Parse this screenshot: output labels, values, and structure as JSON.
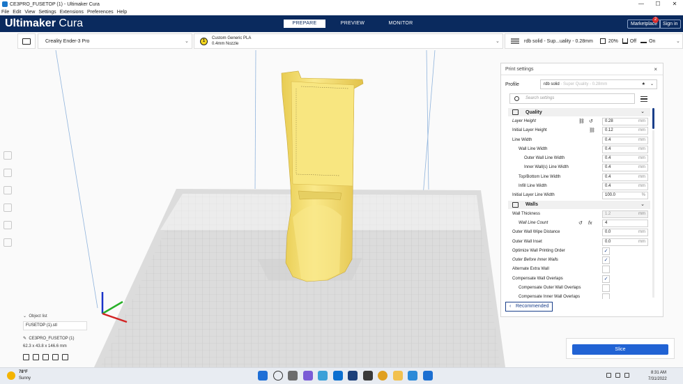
{
  "window": {
    "title": "CE3PRO_FUSETOP (1) - Ultimaker Cura",
    "minimize": "—",
    "maximize": "☐",
    "close": "✕"
  },
  "menu": [
    "File",
    "Edit",
    "View",
    "Settings",
    "Extensions",
    "Preferences",
    "Help"
  ],
  "header": {
    "logo_bold": "Ultimaker",
    "logo_light": " Cura",
    "stages": [
      "PREPARE",
      "PREVIEW",
      "MONITOR"
    ],
    "active_stage": 0,
    "marketplace": "Marketplace",
    "marketplace_badge": "2",
    "signin": "Sign in"
  },
  "toolbar": {
    "printer": "Creality Ender-3 Pro",
    "extruder_number": "1",
    "material": "Custom Generic PLA",
    "nozzle": "0.4mm Nozzle",
    "profile_summary": "rdb solid - Sup...uality - 0.28mm",
    "infill": "20%",
    "support": "Off",
    "adhesion": "On"
  },
  "object_list": {
    "label": "Object list",
    "file": "FUSETOP (1).stl",
    "object_name": "CE3PRO_FUSETOP (1)",
    "dimensions": "62.3 x 43.8 x 146.6 mm"
  },
  "print_settings": {
    "title": "Print settings",
    "close": "×",
    "profile_label": "Profile",
    "profile_name": "rdb solid",
    "profile_sub": " - Super Quality - 0.28mm",
    "search_placeholder": "Search settings",
    "categories": {
      "quality": "Quality",
      "walls": "Walls"
    },
    "quality_rows": [
      {
        "label": "Layer Height",
        "value": "0.28",
        "unit": "mm"
      },
      {
        "label": "Initial Layer Height",
        "value": "0.12",
        "unit": "mm"
      },
      {
        "label": "Line Width",
        "value": "0.4",
        "unit": "mm"
      },
      {
        "label": "Wall Line Width",
        "value": "0.4",
        "unit": "mm"
      },
      {
        "label": "Outer Wall Line Width",
        "value": "0.4",
        "unit": "mm"
      },
      {
        "label": "Inner Wall(s) Line Width",
        "value": "0.4",
        "unit": "mm"
      },
      {
        "label": "Top/Bottom Line Width",
        "value": "0.4",
        "unit": "mm"
      },
      {
        "label": "Infill Line Width",
        "value": "0.4",
        "unit": "mm"
      },
      {
        "label": "Initial Layer Line Width",
        "value": "100.0",
        "unit": "%"
      }
    ],
    "wall_rows": [
      {
        "label": "Wall Thickness",
        "value": "1.2",
        "unit": "mm"
      },
      {
        "label": "Wall Line Count",
        "value": "4",
        "unit": ""
      },
      {
        "label": "Outer Wall Wipe Distance",
        "value": "0.0",
        "unit": "mm"
      },
      {
        "label": "Outer Wall Inset",
        "value": "0.0",
        "unit": "mm"
      }
    ],
    "check_rows": [
      {
        "label": "Optimize Wall Printing Order",
        "checked": "✓"
      },
      {
        "label": "Outer Before Inner Walls",
        "checked": "✓"
      },
      {
        "label": "Alternate Extra Wall",
        "checked": ""
      },
      {
        "label": "Compensate Wall Overlaps",
        "checked": "✓"
      },
      {
        "label": "Compensate Outer Wall Overlaps",
        "checked": ""
      },
      {
        "label": "Compensate Inner Wall Overlaps",
        "checked": ""
      }
    ],
    "recommended": "Recommended"
  },
  "slice_button": "Slice",
  "taskbar": {
    "temperature": "78°F",
    "condition": "Sunny",
    "time": "8:31 AM",
    "date": "7/31/2022"
  },
  "colors": {
    "header": "#0a2a5e",
    "accent": "#2163d4",
    "model": "#f7e27a",
    "build_plate": "#d9d9d9"
  }
}
